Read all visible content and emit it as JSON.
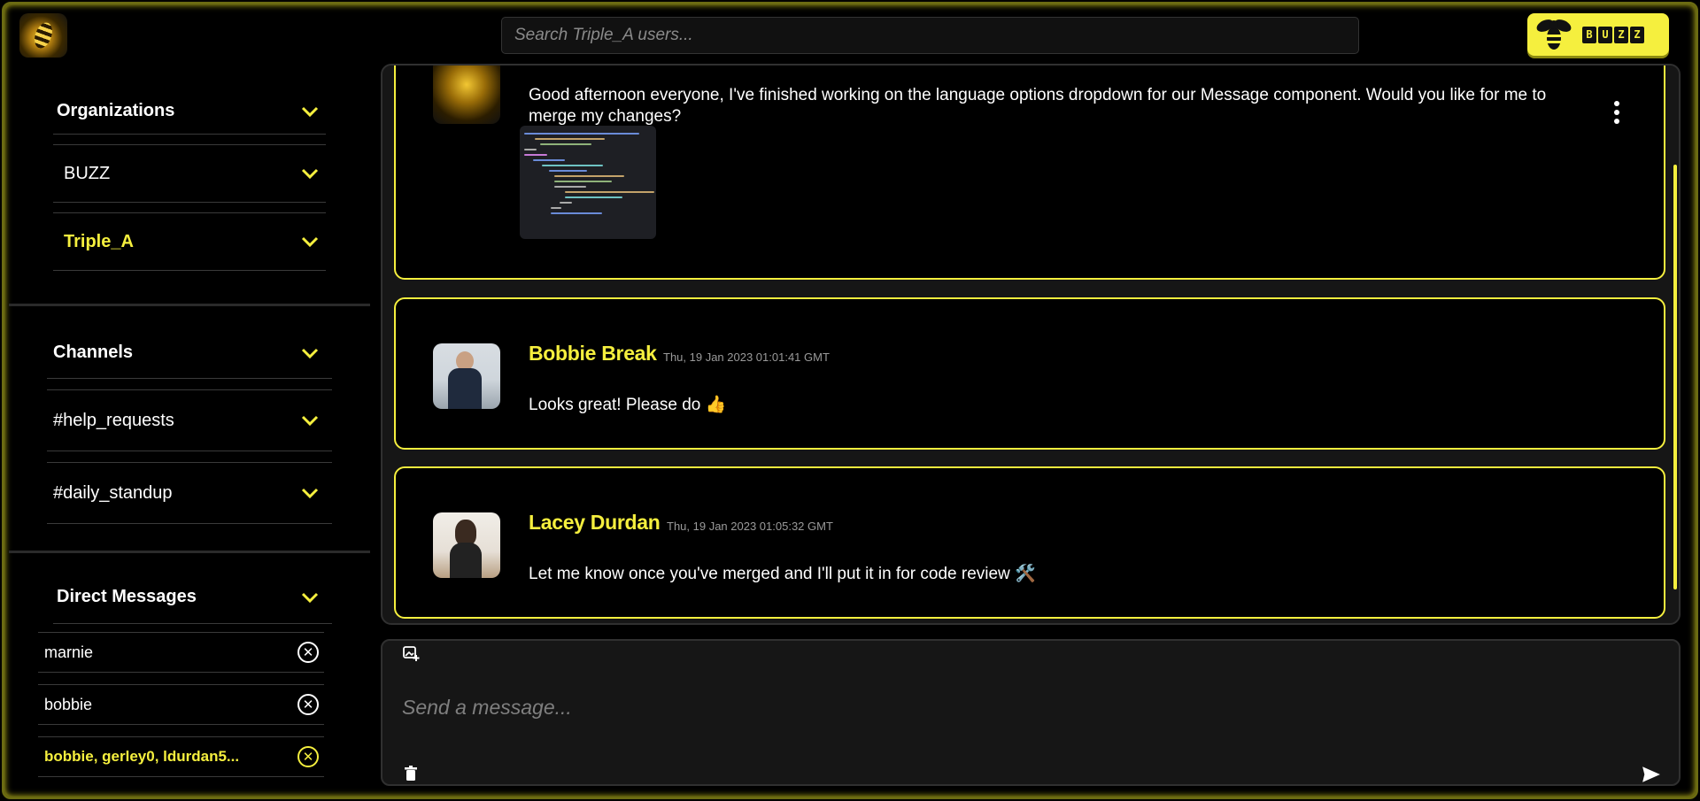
{
  "header": {
    "search_placeholder": "Search Triple_A users...",
    "brand_letters": [
      "B",
      "U",
      "Z",
      "Z"
    ]
  },
  "sidebar": {
    "organizations": {
      "title": "Organizations",
      "items": [
        {
          "label": "BUZZ"
        },
        {
          "label": "Triple_A"
        }
      ]
    },
    "channels": {
      "title": "Channels",
      "items": [
        {
          "label": "#help_requests"
        },
        {
          "label": "#daily_standup"
        }
      ]
    },
    "direct_messages": {
      "title": "Direct Messages",
      "items": [
        {
          "label": "marnie"
        },
        {
          "label": "bobbie"
        },
        {
          "label": "bobbie, gerley0, ldurdan5..."
        }
      ]
    }
  },
  "messages": [
    {
      "author": "",
      "timestamp": "",
      "text": "Good afternoon everyone, I've finished working on the language options dropdown for our Message component. Would you like for me to merge my changes?"
    },
    {
      "author": "Bobbie Break",
      "timestamp": "Thu, 19 Jan 2023 01:01:41 GMT",
      "text": "Looks great! Please do 👍"
    },
    {
      "author": "Lacey Durdan",
      "timestamp": "Thu, 19 Jan 2023 01:05:32 GMT",
      "text": "Let me know once you've merged and I'll put it in for code review 🛠️"
    }
  ],
  "composer": {
    "placeholder": "Send a message..."
  },
  "icons": {
    "chevron": "chevron-down-icon",
    "close": "close-circle-icon",
    "attach": "add-image-icon",
    "delete": "trash-icon",
    "send": "send-icon",
    "more": "more-vertical-icon"
  },
  "colors": {
    "accent": "#f5ef3e",
    "background": "#000000",
    "panel": "#161616"
  }
}
